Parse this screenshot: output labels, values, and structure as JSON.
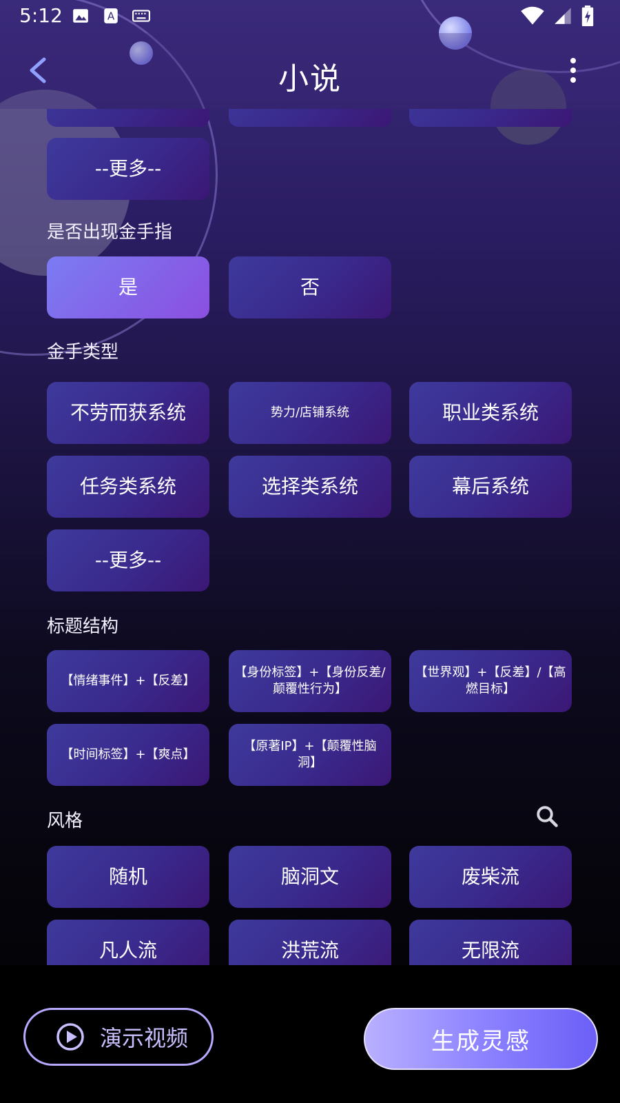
{
  "status_bar": {
    "time": "5:12",
    "icons": [
      "gallery-icon",
      "text-a-icon",
      "keyboard-icon",
      "wifi-icon",
      "signal-icon",
      "battery-charging-icon"
    ]
  },
  "header": {
    "title": "小说",
    "back_icon": "chevron-left-icon",
    "menu_icon": "more-vert-icon"
  },
  "sections": {
    "top_more": "--更多--",
    "golden_finger": {
      "label": "是否出现金手指",
      "options": [
        "是",
        "否"
      ],
      "selected": "是"
    },
    "finger_type": {
      "label": "金手类型",
      "options": [
        "不劳而获系统",
        "势力/店铺系统",
        "职业类系统",
        "任务类系统",
        "选择类系统",
        "幕后系统",
        "--更多--"
      ]
    },
    "title_structure": {
      "label": "标题结构",
      "options": [
        "【情绪事件】+【反差】",
        "【身份标签】+【身份反差/颠覆性行为】",
        "【世界观】+【反差】/【高燃目标】",
        "【时间标签】+【爽点】",
        "【原著IP】+【颠覆性脑洞】"
      ]
    },
    "style": {
      "label": "风格",
      "options": [
        "随机",
        "脑洞文",
        "废柴流",
        "凡人流",
        "洪荒流",
        "无限流"
      ]
    }
  },
  "bottom": {
    "demo_label": "演示视频",
    "generate_label": "生成灵感"
  },
  "colors": {
    "button_bg": "#3b2b8f",
    "selected_bg": "#8050e6",
    "accent": "#b7a9ff"
  }
}
